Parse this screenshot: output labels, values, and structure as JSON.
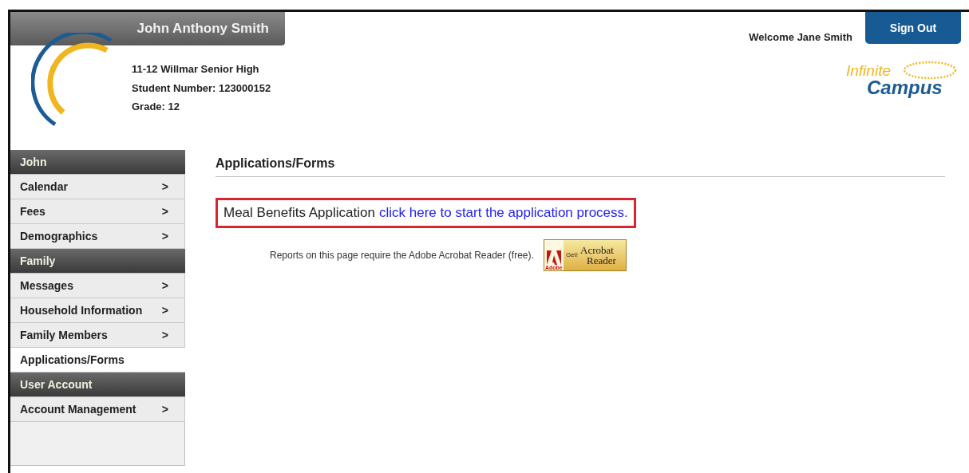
{
  "header": {
    "student_name": "John Anthony Smith",
    "school": "11-12 Willmar Senior High",
    "student_number": "Student Number: 123000152",
    "grade": "Grade: 12",
    "welcome": "Welcome Jane Smith",
    "sign_out": "Sign Out",
    "logo": {
      "word_1": "Infinite",
      "word_2": "Campus"
    }
  },
  "sidebar": {
    "items": [
      {
        "kind": "header",
        "label": "John"
      },
      {
        "kind": "item",
        "label": "Calendar",
        "selected": false,
        "chevron": ">"
      },
      {
        "kind": "item",
        "label": "Fees",
        "selected": false,
        "chevron": ">"
      },
      {
        "kind": "item",
        "label": "Demographics",
        "selected": false,
        "chevron": ">"
      },
      {
        "kind": "header",
        "label": "Family"
      },
      {
        "kind": "item",
        "label": "Messages",
        "selected": false,
        "chevron": ">"
      },
      {
        "kind": "item",
        "label": "Household Information",
        "selected": false,
        "chevron": ">"
      },
      {
        "kind": "item",
        "label": "Family Members",
        "selected": false,
        "chevron": ">"
      },
      {
        "kind": "item",
        "label": "Applications/Forms",
        "selected": true
      },
      {
        "kind": "header",
        "label": "User Account"
      },
      {
        "kind": "item",
        "label": "Account Management",
        "selected": false,
        "chevron": ">"
      }
    ]
  },
  "content": {
    "title": "Applications/Forms",
    "application": {
      "label": "Meal Benefits Application",
      "link": "click here to start the application process."
    },
    "note": "Reports on this page require the Adobe Acrobat Reader (free).",
    "badge": {
      "brand": "Adobe",
      "get": "Get!",
      "product_1": "Acrobat",
      "product_2": "Reader"
    }
  }
}
